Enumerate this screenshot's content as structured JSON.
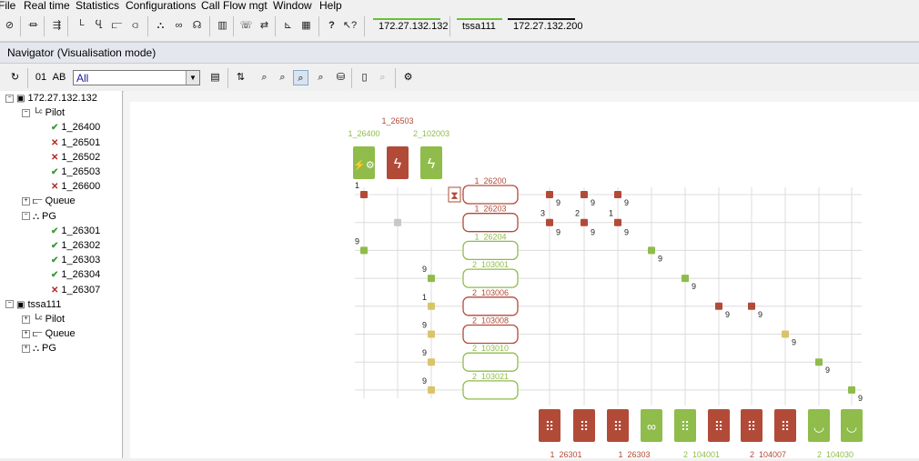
{
  "menu": [
    "File",
    "Real time",
    "Statistics",
    "Configurations",
    "Call Flow mgt",
    "Window",
    "Help"
  ],
  "toolbar": {
    "servers": [
      {
        "label": "172.27.132.132",
        "color": "#6abf3a"
      },
      {
        "label": "tssa111",
        "color": "#6abf3a"
      },
      {
        "label": "172.27.132.200",
        "color": "#111111"
      }
    ]
  },
  "navigator": {
    "title": "Navigator (Visualisation mode)",
    "display_buttons": [
      "01",
      "AB"
    ],
    "filter_value": "All"
  },
  "tree": {
    "servers": [
      {
        "name": "172.27.132.132",
        "groups": [
          {
            "name": "Pilot",
            "items": [
              {
                "name": "1_26400",
                "status": "ok"
              },
              {
                "name": "1_26501",
                "status": "ko"
              },
              {
                "name": "1_26502",
                "status": "ko"
              },
              {
                "name": "1_26503",
                "status": "ok"
              },
              {
                "name": "1_26600",
                "status": "ko"
              }
            ]
          },
          {
            "name": "Queue",
            "items": []
          },
          {
            "name": "PG",
            "items": [
              {
                "name": "1_26301",
                "status": "ok"
              },
              {
                "name": "1_26302",
                "status": "ok"
              },
              {
                "name": "1_26303",
                "status": "ok"
              },
              {
                "name": "1_26304",
                "status": "ok"
              },
              {
                "name": "1_26307",
                "status": "ko"
              }
            ]
          }
        ]
      },
      {
        "name": "tssa111",
        "groups": [
          {
            "name": "Pilot",
            "items": []
          },
          {
            "name": "Queue",
            "items": []
          },
          {
            "name": "PG",
            "items": []
          }
        ]
      }
    ]
  },
  "flow": {
    "colors": {
      "green": "#8fbc4a",
      "red": "#b24a38",
      "yellow": "#d9c46a",
      "gray": "#c8c8c8",
      "line": "#dcdcdc"
    },
    "pilots": [
      {
        "label": "1_26400",
        "color": "green",
        "icon": "pilot-active-icon"
      },
      {
        "label": "1_26503",
        "color": "red",
        "icon": "pilot-icon"
      },
      {
        "label": "2_102003",
        "color": "green",
        "icon": "pilot-icon"
      }
    ],
    "queues": [
      {
        "label": "1_26200",
        "color": "red",
        "hourglass": true
      },
      {
        "label": "1_26203",
        "color": "red",
        "hourglass": false
      },
      {
        "label": "1_26204",
        "color": "green",
        "hourglass": false
      },
      {
        "label": "2_103001",
        "color": "green",
        "hourglass": false
      },
      {
        "label": "2_103006",
        "color": "red",
        "hourglass": false
      },
      {
        "label": "2_103008",
        "color": "red",
        "hourglass": false
      },
      {
        "label": "2_103010",
        "color": "green",
        "hourglass": false
      },
      {
        "label": "2_103021",
        "color": "green",
        "hourglass": false
      }
    ],
    "left_nodes": [
      {
        "col": 0,
        "row": 0,
        "color": "red",
        "label": "1"
      },
      {
        "col": 1,
        "row": 1,
        "color": "gray",
        "label": ""
      },
      {
        "col": 0,
        "row": 2,
        "color": "green",
        "label": "9"
      },
      {
        "col": 2,
        "row": 3,
        "color": "green",
        "label": "9"
      },
      {
        "col": 2,
        "row": 4,
        "color": "yellow",
        "label": "1"
      },
      {
        "col": 2,
        "row": 5,
        "color": "yellow",
        "label": "9"
      },
      {
        "col": 2,
        "row": 6,
        "color": "yellow",
        "label": "9"
      },
      {
        "col": 2,
        "row": 7,
        "color": "yellow",
        "label": "9"
      }
    ],
    "right_nodes": [
      {
        "col": 0,
        "row": 0,
        "color": "red",
        "label": "9"
      },
      {
        "col": 1,
        "row": 0,
        "color": "red",
        "label": "9"
      },
      {
        "col": 2,
        "row": 0,
        "color": "red",
        "label": "9"
      },
      {
        "col": 0,
        "row": 1,
        "color": "red",
        "label": "3"
      },
      {
        "col": 1,
        "row": 1,
        "color": "red",
        "label": "2"
      },
      {
        "col": 2,
        "row": 1,
        "color": "red",
        "label": "1"
      },
      {
        "col": 0,
        "row": 1.33,
        "color": "",
        "label": "9"
      },
      {
        "col": 1,
        "row": 1.33,
        "color": "",
        "label": "9"
      },
      {
        "col": 2,
        "row": 1.33,
        "color": "",
        "label": "9"
      },
      {
        "col": 3,
        "row": 2,
        "color": "green",
        "label": "9"
      },
      {
        "col": 4,
        "row": 3,
        "color": "green",
        "label": "9"
      },
      {
        "col": 5,
        "row": 4,
        "color": "red",
        "label": "9"
      },
      {
        "col": 6,
        "row": 4,
        "color": "red",
        "label": "9"
      },
      {
        "col": 7,
        "row": 5,
        "color": "yellow",
        "label": "9"
      },
      {
        "col": 8,
        "row": 6,
        "color": "green",
        "label": "9"
      },
      {
        "col": 9,
        "row": 7,
        "color": "green",
        "label": "9"
      }
    ],
    "right_node_label_prefix": [
      "9",
      "9",
      "9",
      "3",
      "2",
      "1",
      "9",
      "9",
      "9",
      "9",
      "9",
      "9",
      "9",
      "9",
      "9",
      "9"
    ],
    "targets": [
      {
        "color": "red",
        "icon": "pg-icon",
        "label": "1_26301"
      },
      {
        "color": "red",
        "icon": "pg-icon",
        "label": ""
      },
      {
        "color": "red",
        "icon": "pg-icon",
        "label": "1_26303"
      },
      {
        "color": "green",
        "icon": "voicemail-icon",
        "label": ""
      },
      {
        "color": "green",
        "icon": "pg-icon",
        "label": "2_104001"
      },
      {
        "color": "red",
        "icon": "pg-icon",
        "label": ""
      },
      {
        "color": "red",
        "icon": "pg-icon",
        "label": "2_104007"
      },
      {
        "color": "red",
        "icon": "pg-icon",
        "label": ""
      },
      {
        "color": "green",
        "icon": "handset-icon",
        "label": "2_104030"
      },
      {
        "color": "green",
        "icon": "handset-icon",
        "label": ""
      }
    ]
  }
}
